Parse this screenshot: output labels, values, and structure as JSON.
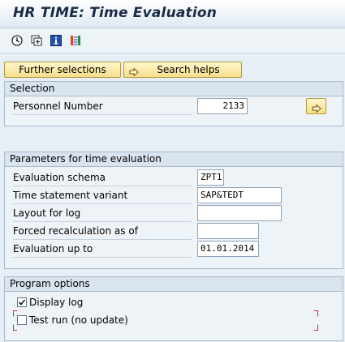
{
  "title": "HR TIME: Time Evaluation",
  "toolbar": {
    "icons": [
      "execute-icon",
      "variant-icon",
      "info-icon",
      "program-doc-icon"
    ]
  },
  "buttons": {
    "further_selections": "Further selections",
    "search_helps": "Search helps"
  },
  "selection": {
    "header": "Selection",
    "personnel_number_label": "Personnel Number",
    "personnel_number_value": "2133"
  },
  "parameters": {
    "header": "Parameters for time evaluation",
    "evaluation_schema_label": "Evaluation schema",
    "evaluation_schema_value": "ZPT1",
    "time_statement_variant_label": "Time statement variant",
    "time_statement_variant_value": "SAP&TEDT",
    "layout_for_log_label": "Layout for log",
    "layout_for_log_value": "",
    "forced_recalculation_label": "Forced recalculation as of",
    "forced_recalculation_value": "",
    "evaluation_up_to_label": "Evaluation up to",
    "evaluation_up_to_value": "01.01.2014"
  },
  "program_options": {
    "header": "Program options",
    "display_log_label": "Display log",
    "display_log_checked": true,
    "test_run_label": "Test run (no update)",
    "test_run_checked": false
  },
  "colors": {
    "background": "#e6eef6",
    "button_yellow": "#f6de8a",
    "group_header": "#d9e4ef",
    "bracket_red": "#d9302b"
  }
}
